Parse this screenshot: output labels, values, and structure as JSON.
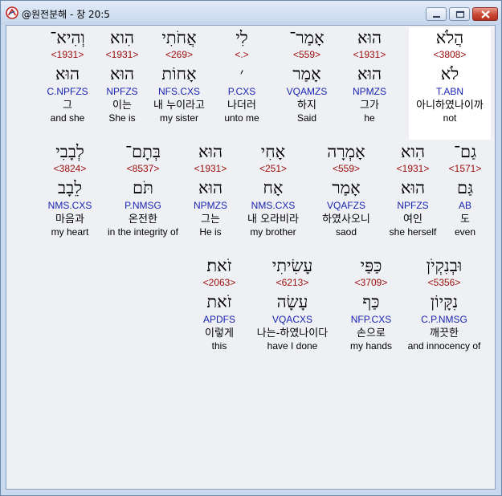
{
  "window": {
    "title": "@원전분해 - 창 20:5"
  },
  "rows": [
    [
      {
        "hebrew": "הֲלֹא",
        "strong": "<3808>",
        "lemma": "לֹא",
        "morph": "T.ABN",
        "korean": "아니하였나이까",
        "english": "not",
        "selected": true
      },
      {
        "hebrew": "הוּא",
        "strong": "<1931>",
        "lemma": "הוּא",
        "morph": "NPMZS",
        "korean": "그가",
        "english": "he"
      },
      {
        "hebrew": "אָמַר־",
        "strong": "<559>",
        "lemma": "אָמַר",
        "morph": "VQAMZS",
        "korean": "하지",
        "english": "Said"
      },
      {
        "hebrew": "לִי",
        "strong": "<.>",
        "lemma": "׳",
        "morph": "P.CXS",
        "korean": "나더러",
        "english": "unto me"
      },
      {
        "hebrew": "אֲחֹתִי",
        "strong": "<269>",
        "lemma": "אָחוֹת",
        "morph": "NFS.CXS",
        "korean": "내 누이라고",
        "english": "my sister"
      },
      {
        "hebrew": "הִוא",
        "strong": "<1931>",
        "lemma": "הוּא",
        "morph": "NPFZS",
        "korean": "이는",
        "english": "She is"
      },
      {
        "hebrew": "וְהִיא־",
        "strong": "<1931>",
        "lemma": "הוּא",
        "morph": "C.NPFZS",
        "korean": "그",
        "english": "and she"
      }
    ],
    [
      {
        "hebrew": "גַם־",
        "strong": "<1571>",
        "lemma": "גַּם",
        "morph": "AB",
        "korean": "도",
        "english": "even"
      },
      {
        "hebrew": "הִוא",
        "strong": "<1931>",
        "lemma": "הוּא",
        "morph": "NPFZS",
        "korean": "여인",
        "english": "she herself"
      },
      {
        "hebrew": "אָמְרָה",
        "strong": "<559>",
        "lemma": "אָמַר",
        "morph": "VQAFZS",
        "korean": "하였사오니",
        "english": "saod"
      },
      {
        "hebrew": "אָחִי",
        "strong": "<251>",
        "lemma": "אָח",
        "morph": "NMS.CXS",
        "korean": "내 오라비라",
        "english": "my brother"
      },
      {
        "hebrew": "הוּא",
        "strong": "<1931>",
        "lemma": "הוּא",
        "morph": "NPMZS",
        "korean": "그는",
        "english": "He is"
      },
      {
        "hebrew": "בְּתָם־",
        "strong": "<8537>",
        "lemma": "תֹּם",
        "morph": "P.NMSG",
        "korean": "온전한",
        "english": "in the integrity of"
      },
      {
        "hebrew": "לְבָבִי",
        "strong": "<3824>",
        "lemma": "לֵבָב",
        "morph": "NMS.CXS",
        "korean": "마음과",
        "english": "my heart"
      }
    ],
    [
      {
        "hebrew": "וּבְנִקְיֹן",
        "strong": "<5356>",
        "lemma": "נִקָּיוֹן",
        "morph": "C.P.NMSG",
        "korean": "깨끗한",
        "english": "and innocency of"
      },
      {
        "hebrew": "כַּפַּי",
        "strong": "<3709>",
        "lemma": "כַּף",
        "morph": "NFP.CXS",
        "korean": "손으로",
        "english": "my hands"
      },
      {
        "hebrew": "עָשִׂיתִי",
        "strong": "<6213>",
        "lemma": "עָשָׂה",
        "morph": "VQACXS",
        "korean": "나는-하였나이다",
        "english": "have I done"
      },
      {
        "hebrew": "זֹאת׃",
        "strong": "<2063>",
        "lemma": "זֹאת",
        "morph": "APDFS",
        "korean": "이렇게",
        "english": "this"
      }
    ]
  ]
}
